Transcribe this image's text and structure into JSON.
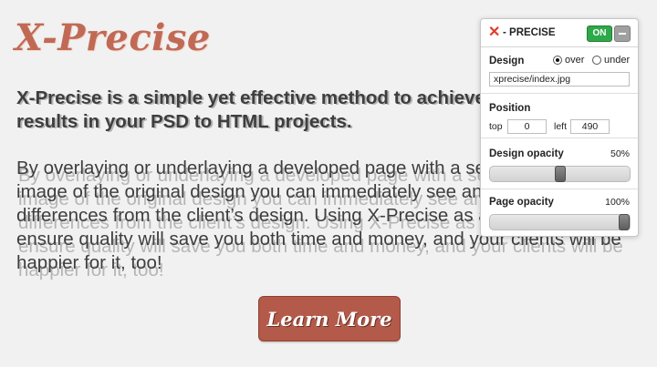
{
  "site": {
    "logo": "X-Precise",
    "intro_line1": "X-Precise is a simple yet effective method to achieve pixel precise",
    "intro_line2": "results in your PSD to HTML projects.",
    "body_line1": "By overlaying or underlaying a developed page with a semi-transparent",
    "body_line2": "image of the original design you can immediately see and repair any",
    "body_line3": "differences from the client’s design. Using X-Precise as a tool will",
    "body_line4": "ensure quality will save you both time and money, and your clients will be",
    "body_line5": "happier for it, too!",
    "cta_label": "Learn More"
  },
  "panel": {
    "title": "- PRECISE",
    "on_label": "ON",
    "design_label": "Design",
    "over_label": "over",
    "under_label": "under",
    "design_mode": "over",
    "image_path": "xprecise/index.jpg",
    "position_label": "Position",
    "top_label": "top",
    "top_value": "0",
    "left_label": "left",
    "left_value": "490",
    "design_opacity_label": "Design opacity",
    "design_opacity": "50%",
    "design_opacity_value": 0.5,
    "page_opacity_label": "Page opacity",
    "page_opacity": "100%",
    "page_opacity_value": 1.0,
    "accent_color": "#2fa84a",
    "close_color": "#e33b2c"
  }
}
